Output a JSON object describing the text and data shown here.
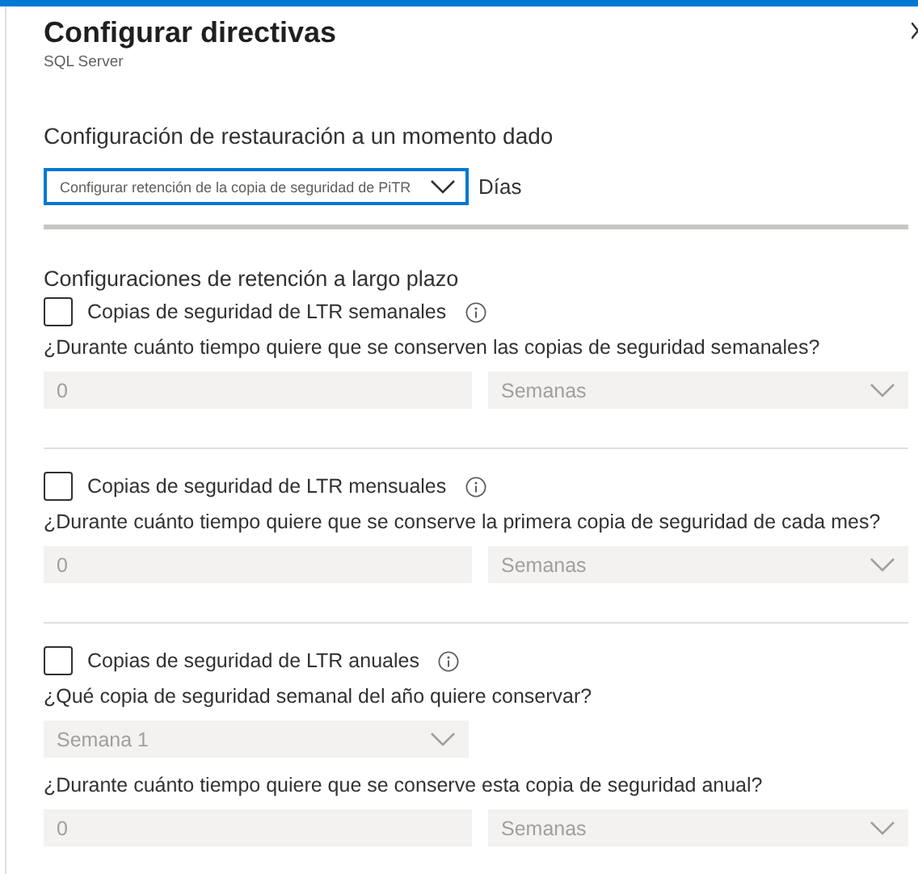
{
  "panel": {
    "title": "Configurar directivas",
    "subtitle": "SQL Server"
  },
  "pitr": {
    "heading": "Configuración de restauración a un momento dado",
    "dropdown": {
      "value": "Configurar retención de la copia de seguridad de PiTR"
    },
    "unit": "Días"
  },
  "ltr": {
    "heading": "Configuraciones de retención a largo plazo",
    "sections": [
      {
        "label": "Copias de seguridad de LTR semanales",
        "checked": false,
        "rows": [
          {
            "question": "¿Durante cuánto tiempo quiere que se conserven las copias de seguridad semanales?",
            "fields": [
              {
                "kind": "number",
                "value": "0",
                "disabled": true
              },
              {
                "kind": "select",
                "value": "Semanas",
                "disabled": true
              }
            ]
          }
        ]
      },
      {
        "label": "Copias de seguridad de LTR mensuales",
        "checked": false,
        "rows": [
          {
            "question": "¿Durante cuánto tiempo quiere que se conserve la primera copia de seguridad de cada mes?",
            "fields": [
              {
                "kind": "number",
                "value": "0",
                "disabled": true
              },
              {
                "kind": "select",
                "value": "Semanas",
                "disabled": true
              }
            ]
          }
        ]
      },
      {
        "label": "Copias de seguridad de LTR anuales",
        "checked": false,
        "rows": [
          {
            "question": "¿Qué copia de seguridad semanal del año quiere conservar?",
            "fields": [
              {
                "kind": "select-half",
                "value": "Semana 1",
                "disabled": true
              }
            ]
          },
          {
            "question": "¿Durante cuánto tiempo quiere que se conserve esta copia de seguridad anual?",
            "fields": [
              {
                "kind": "number",
                "value": "0",
                "disabled": true
              },
              {
                "kind": "select",
                "value": "Semanas",
                "disabled": true
              }
            ]
          }
        ]
      }
    ]
  }
}
